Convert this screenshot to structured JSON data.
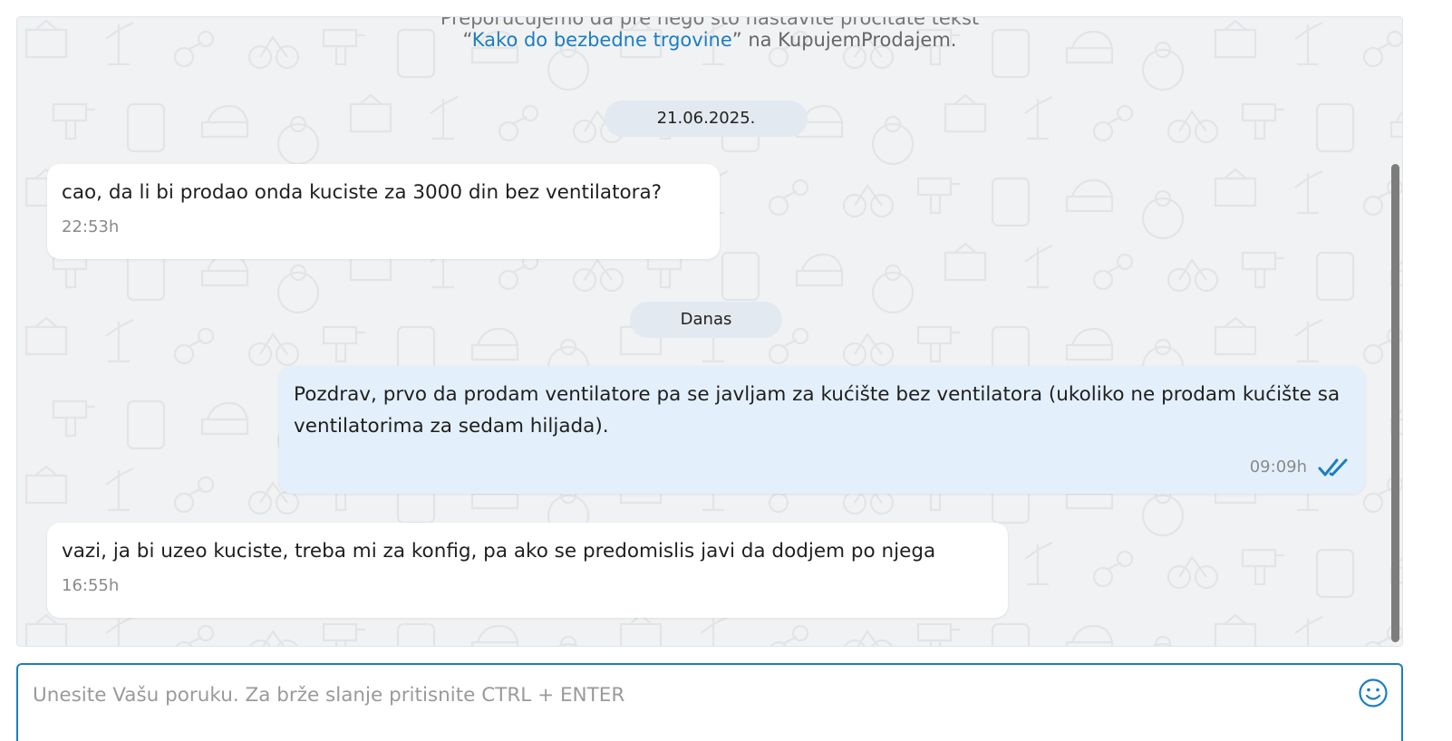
{
  "notice": {
    "partial_line": "Preporučujemo da pre nego što nastavite pročitate tekst",
    "open_quote": "“",
    "link": "Kako do bezbedne trgovine",
    "suffix": "” na KupujemProdajem."
  },
  "dates": {
    "first": "21.06.2025.",
    "today": "Danas"
  },
  "messages": [
    {
      "direction": "incoming",
      "text": "cao, da li bi prodao onda kuciste za 3000 din bez ventilatora?",
      "time": "22:53h"
    },
    {
      "direction": "outgoing",
      "text": "Pozdrav, prvo da prodam ventilatore pa se javljam za kućište bez ventilatora (ukoliko ne prodam kućište sa ventilatorima za sedam hiljada).",
      "time": "09:09h",
      "status_icon": "double-check-icon"
    },
    {
      "direction": "incoming",
      "text": "vazi, ja bi uzeo kuciste, treba mi za konfig, pa ako se predomislis javi da dodjem po njega",
      "time": "16:55h"
    }
  ],
  "composer": {
    "placeholder": "Unesite Vašu poruku. Za brže slanje pritisnite CTRL + ENTER",
    "value": "",
    "emoji_icon": "smiley-icon"
  },
  "colors": {
    "accent": "#1a7ec2",
    "outgoing_bubble": "#e3f0fb",
    "incoming_bubble": "#ffffff",
    "chat_background": "#f1f2f3"
  }
}
